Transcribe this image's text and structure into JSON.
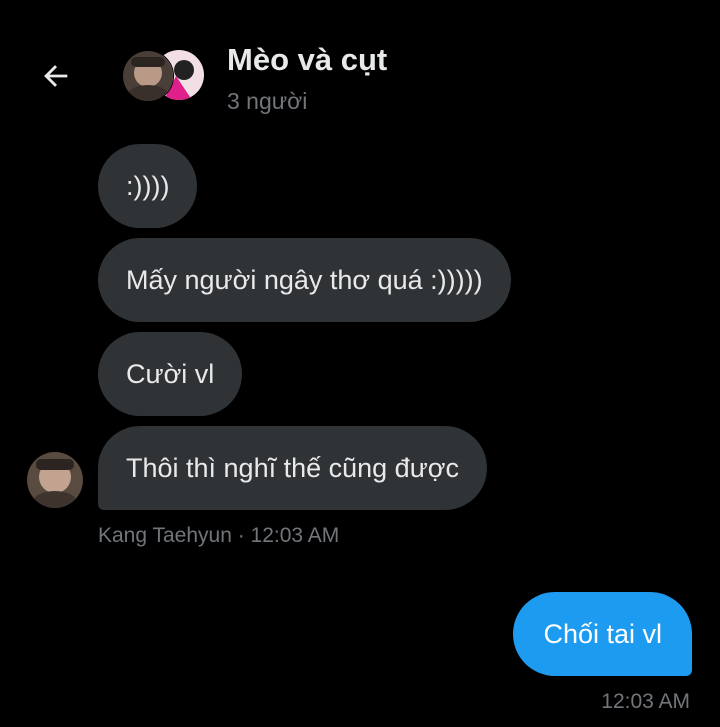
{
  "header": {
    "back_icon": "arrow-left-icon",
    "title": "Mèo và cụt",
    "subtitle": "3 người"
  },
  "messages_received": [
    {
      "text": ":))))"
    },
    {
      "text": "Mấy người ngây thơ quá :)))))"
    },
    {
      "text": "Cười vl"
    },
    {
      "text": "Thôi thì nghĩ thế cũng được"
    }
  ],
  "received_meta": "Kang Taehyun · 12:03 AM",
  "message_sent": {
    "text": "Chối tai vl",
    "time": "12:03 AM"
  },
  "colors": {
    "background": "#000000",
    "bubble_received": "#2f3336",
    "bubble_sent": "#1d9bf0",
    "text_primary": "#e7e9ea",
    "text_secondary": "#71767b"
  }
}
